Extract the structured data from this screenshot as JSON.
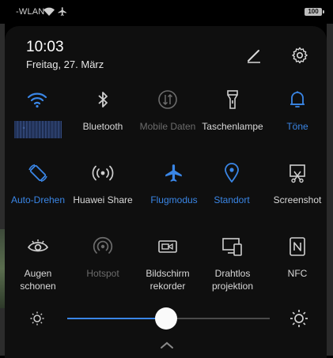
{
  "status_bar": {
    "network_text": "-WLAN",
    "battery": "100"
  },
  "header": {
    "time": "10:03",
    "date": "Freitag, 27. März",
    "edit_icon": "edit-icon",
    "settings_icon": "gear-icon"
  },
  "tiles": {
    "wifi": {
      "label": "",
      "state": "active",
      "icon": "wifi-icon"
    },
    "bluetooth": {
      "label": "Bluetooth",
      "state": "inactive",
      "icon": "bluetooth-icon"
    },
    "mobile_data": {
      "label": "Mobile Daten",
      "state": "disabled",
      "icon": "mobile-data-icon"
    },
    "flashlight": {
      "label": "Taschenlampe",
      "state": "inactive",
      "icon": "flashlight-icon"
    },
    "sound": {
      "label": "Töne",
      "state": "active",
      "icon": "bell-icon"
    },
    "auto_rotate": {
      "label": "Auto-Drehen",
      "state": "active",
      "icon": "rotate-icon"
    },
    "huawei_share": {
      "label": "Huawei Share",
      "state": "inactive",
      "icon": "share-signal-icon"
    },
    "airplane": {
      "label": "Flugmodus",
      "state": "active",
      "icon": "airplane-icon"
    },
    "location": {
      "label": "Standort",
      "state": "active",
      "icon": "location-pin-icon"
    },
    "screenshot": {
      "label": "Screenshot",
      "state": "inactive",
      "icon": "screenshot-icon"
    },
    "eye_comfort": {
      "label_line1": "Augen",
      "label_line2": "schonen",
      "state": "inactive",
      "icon": "eye-icon"
    },
    "hotspot": {
      "label": "Hotspot",
      "state": "disabled",
      "icon": "hotspot-icon"
    },
    "screen_recorder": {
      "label_line1": "Bildschirm",
      "label_line2": "rekorder",
      "state": "inactive",
      "icon": "video-record-icon"
    },
    "wireless_projection": {
      "label_line1": "Drahtlos",
      "label_line2": "projektion",
      "state": "inactive",
      "icon": "projection-icon"
    },
    "nfc": {
      "label": "NFC",
      "state": "inactive",
      "icon": "nfc-icon"
    }
  },
  "brightness": {
    "level": 0.49,
    "low_icon": "brightness-low-icon",
    "high_icon": "brightness-high-icon"
  },
  "colors": {
    "accent": "#3a86e6",
    "inactive_icon": "#cfcfcf",
    "disabled": "#6c6c6c",
    "panel": "#0f0f0f"
  }
}
